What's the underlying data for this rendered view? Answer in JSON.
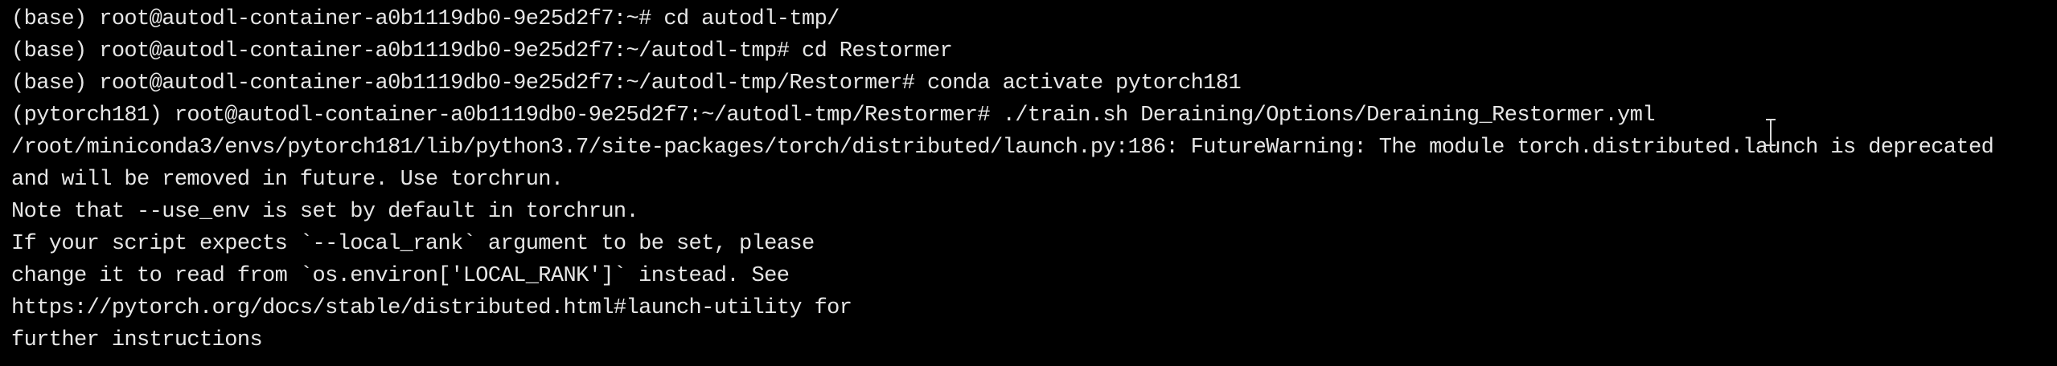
{
  "terminal": {
    "lines": [
      "(base) root@autodl-container-a0b1119db0-9e25d2f7:~# cd autodl-tmp/",
      "(base) root@autodl-container-a0b1119db0-9e25d2f7:~/autodl-tmp# cd Restormer",
      "(base) root@autodl-container-a0b1119db0-9e25d2f7:~/autodl-tmp/Restormer# conda activate pytorch181",
      "(pytorch181) root@autodl-container-a0b1119db0-9e25d2f7:~/autodl-tmp/Restormer# ./train.sh Deraining/Options/Deraining_Restormer.yml",
      "/root/miniconda3/envs/pytorch181/lib/python3.7/site-packages/torch/distributed/launch.py:186: FutureWarning: The module torch.distributed.launch is deprecated",
      "and will be removed in future. Use torchrun.",
      "Note that --use_env is set by default in torchrun.",
      "If your script expects `--local_rank` argument to be set, please",
      "change it to read from `os.environ['LOCAL_RANK']` instead. See",
      "https://pytorch.org/docs/stable/distributed.html#launch-utility for",
      "further instructions"
    ]
  },
  "colors": {
    "background": "#000000",
    "foreground": "#e6e6e6"
  },
  "icons": {
    "cursor": "text-ibeam-cursor-icon"
  }
}
